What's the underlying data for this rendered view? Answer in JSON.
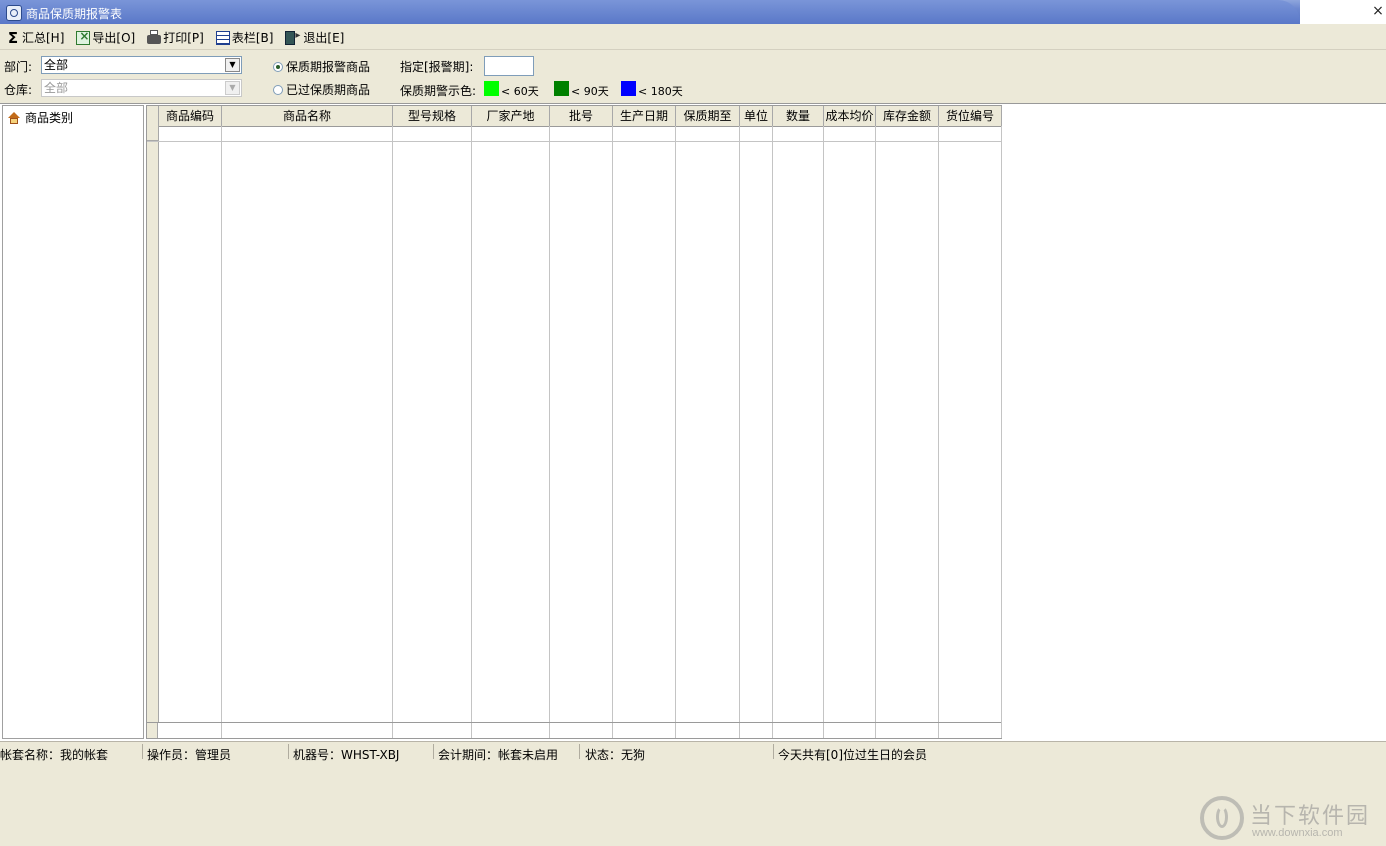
{
  "window": {
    "title": "商品保质期报警表",
    "close_glyph": "×"
  },
  "toolbar": {
    "sum_label": "汇总[H]",
    "export_label": "导出[O]",
    "print_label": "打印[P]",
    "columns_label": "表栏[B]",
    "exit_label": "退出[E]"
  },
  "filters": {
    "dept_label": "部门:",
    "dept_value": "全部",
    "warehouse_label": "仓库:",
    "warehouse_value": "全部",
    "radio_warning": "保质期报警商品",
    "radio_expired": "已过保质期商品",
    "selected_radio": "warning",
    "period_label": "指定[报警期]:",
    "period_value": "",
    "color_label": "保质期警示色:",
    "colors": [
      {
        "label": "< 60天",
        "color": "#00ff00"
      },
      {
        "label": "< 90天",
        "color": "#008000"
      },
      {
        "label": "< 180天",
        "color": "#0000ff"
      }
    ]
  },
  "tree": {
    "root_label": "商品类别"
  },
  "grid": {
    "columns": [
      "商品编码",
      "商品名称",
      "型号规格",
      "厂家产地",
      "批号",
      "生产日期",
      "保质期至",
      "单位",
      "数量",
      "成本均价",
      "库存金额",
      "货位编号"
    ],
    "rows": []
  },
  "status": {
    "account": "帐套名称：我的帐套",
    "operator": "操作员：管理员",
    "machine": "机器号：WHST-XBJ",
    "period": "会计期间：帐套未启用",
    "state": "状态：无狗",
    "birthday": "今天共有[0]位过生日的会员"
  },
  "watermark": {
    "brand": "当下软件园",
    "url": "www.downxia.com"
  }
}
